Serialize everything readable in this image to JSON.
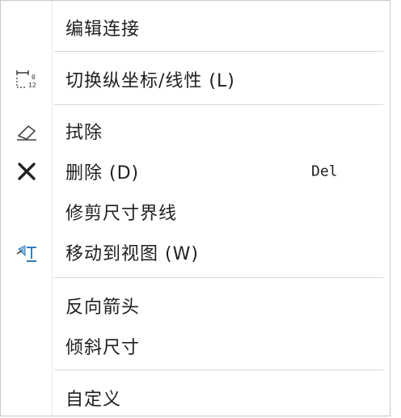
{
  "menu": {
    "items": [
      {
        "label": "编辑连接",
        "icon": null
      },
      {
        "label": "切换纵坐标/线性 (L)",
        "icon": "ordinate-linear-icon"
      },
      {
        "label": "拭除",
        "icon": "eraser-icon"
      },
      {
        "label": "删除 (D)",
        "shortcut": "Del",
        "icon": "delete-x-icon"
      },
      {
        "label": "修剪尺寸界线",
        "icon": null
      },
      {
        "label": "移动到视图 (W)",
        "icon": "move-to-view-icon"
      },
      {
        "label": "反向箭头",
        "icon": null
      },
      {
        "label": "倾斜尺寸",
        "icon": null
      },
      {
        "label": "自定义",
        "icon": null
      }
    ]
  },
  "colors": {
    "text": "#1f1f1f",
    "separator": "#d8d8d8",
    "border": "#c9c9c9",
    "icon_accent": "#2f7fbf"
  }
}
